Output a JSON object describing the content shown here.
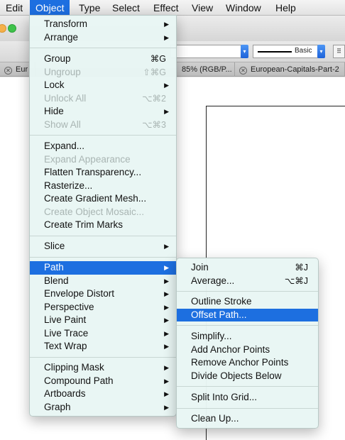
{
  "menubar": {
    "items": [
      "Edit",
      "Object",
      "Type",
      "Select",
      "Effect",
      "View",
      "Window",
      "Help"
    ],
    "active": "Object"
  },
  "control_bar": {
    "stroke_style": "Basic"
  },
  "doc_tabs": [
    "Eur",
    "85% (RGB/P...",
    "European-Capitals-Part-2"
  ],
  "object_menu": {
    "items": [
      {
        "label": "Transform",
        "submenu": true
      },
      {
        "label": "Arrange",
        "submenu": true
      },
      {
        "label": "Group",
        "shortcut": "⌘G"
      },
      {
        "label": "Ungroup",
        "shortcut": "⇧⌘G",
        "disabled": true
      },
      {
        "label": "Lock",
        "submenu": true
      },
      {
        "label": "Unlock All",
        "shortcut": "⌥⌘2",
        "disabled": true
      },
      {
        "label": "Hide",
        "submenu": true
      },
      {
        "label": "Show All",
        "shortcut": "⌥⌘3",
        "disabled": true
      },
      {
        "label": "Expand..."
      },
      {
        "label": "Expand Appearance",
        "disabled": true
      },
      {
        "label": "Flatten Transparency..."
      },
      {
        "label": "Rasterize..."
      },
      {
        "label": "Create Gradient Mesh..."
      },
      {
        "label": "Create Object Mosaic...",
        "disabled": true
      },
      {
        "label": "Create Trim Marks"
      },
      {
        "label": "Slice",
        "submenu": true
      },
      {
        "label": "Path",
        "submenu": true,
        "highlighted": true
      },
      {
        "label": "Blend",
        "submenu": true
      },
      {
        "label": "Envelope Distort",
        "submenu": true
      },
      {
        "label": "Perspective",
        "submenu": true
      },
      {
        "label": "Live Paint",
        "submenu": true
      },
      {
        "label": "Live Trace",
        "submenu": true
      },
      {
        "label": "Text Wrap",
        "submenu": true
      },
      {
        "label": "Clipping Mask",
        "submenu": true
      },
      {
        "label": "Compound Path",
        "submenu": true
      },
      {
        "label": "Artboards",
        "submenu": true
      },
      {
        "label": "Graph",
        "submenu": true
      }
    ]
  },
  "path_submenu": {
    "items": [
      {
        "label": "Join",
        "shortcut": "⌘J"
      },
      {
        "label": "Average...",
        "shortcut": "⌥⌘J"
      },
      {
        "label": "Outline Stroke"
      },
      {
        "label": "Offset Path...",
        "highlighted": true
      },
      {
        "label": "Simplify..."
      },
      {
        "label": "Add Anchor Points"
      },
      {
        "label": "Remove Anchor Points"
      },
      {
        "label": "Divide Objects Below"
      },
      {
        "label": "Split Into Grid..."
      },
      {
        "label": "Clean Up..."
      }
    ]
  },
  "colors": {
    "highlight": "#1d6fe0",
    "menu_background": "#e8f6f4"
  }
}
